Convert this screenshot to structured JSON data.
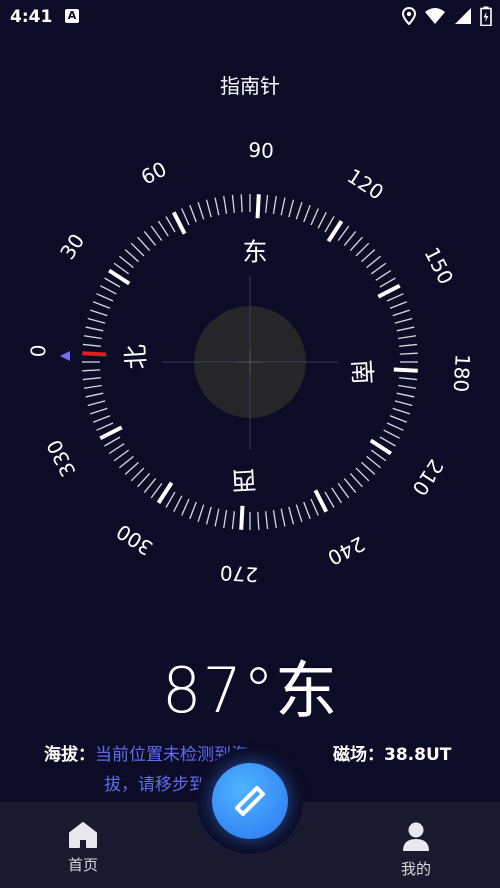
{
  "status_bar": {
    "time": "4:41",
    "a_badge": "A"
  },
  "app": {
    "title": "指南针"
  },
  "compass": {
    "heading_deg": 87,
    "degree_labels": [
      "0",
      "30",
      "60",
      "90",
      "120",
      "150",
      "180",
      "210",
      "240",
      "270",
      "300",
      "330"
    ],
    "cardinals": {
      "north": "北",
      "east": "东",
      "south": "南",
      "west": "西"
    },
    "accent_color": "#e01e1e",
    "pointer_color": "#7b6cf0"
  },
  "readout": {
    "heading_text": "87°东"
  },
  "info": {
    "altitude_label": "海拔：",
    "altitude_value_line1": "当前位置未检测到海",
    "altitude_value_line2": "拔，请移步到",
    "magnetic_label": "磁场：",
    "magnetic_value": "38.8UT"
  },
  "nav": {
    "home_label": "首页",
    "me_label": "我的",
    "fab_icon": "compass-diamond-icon"
  }
}
